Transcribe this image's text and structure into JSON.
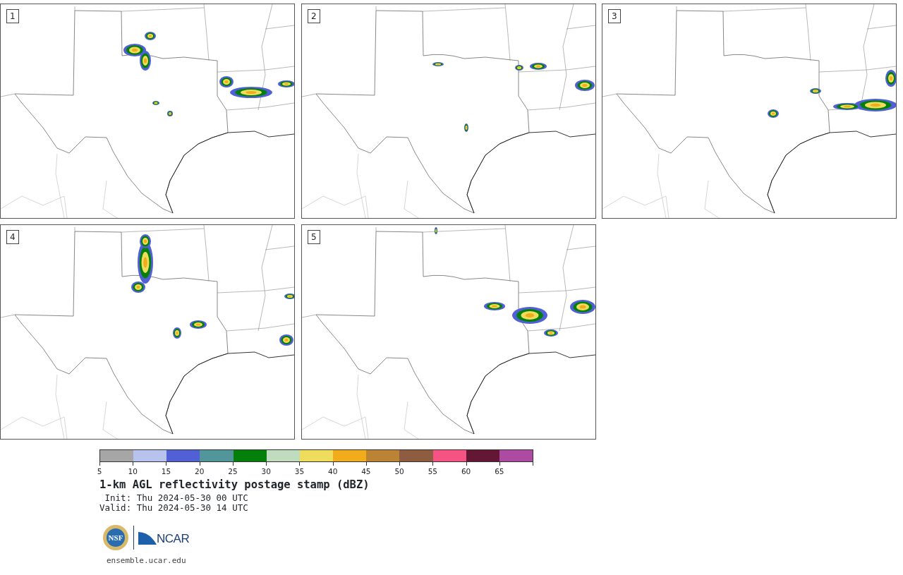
{
  "panels": [
    {
      "label": "1"
    },
    {
      "label": "2"
    },
    {
      "label": "3"
    },
    {
      "label": "4"
    },
    {
      "label": "5"
    }
  ],
  "colorbar": {
    "bins": [
      {
        "color": "#a6a6a6",
        "tick": "5"
      },
      {
        "color": "#b7c3ec",
        "tick": "10"
      },
      {
        "color": "#5260d6",
        "tick": "15"
      },
      {
        "color": "#52969b",
        "tick": "20"
      },
      {
        "color": "#04800a",
        "tick": "25"
      },
      {
        "color": "#bfddbe",
        "tick": "30"
      },
      {
        "color": "#efdb5c",
        "tick": "35"
      },
      {
        "color": "#f0ac1a",
        "tick": "40"
      },
      {
        "color": "#bb8334",
        "tick": "45"
      },
      {
        "color": "#8e5c40",
        "tick": "50"
      },
      {
        "color": "#f55383",
        "tick": "55"
      },
      {
        "color": "#631735",
        "tick": "60"
      },
      {
        "color": "#ad4ba3",
        "tick": "65"
      }
    ]
  },
  "title": "1-km AGL reflectivity postage stamp (dBZ)",
  "init": " Init: Thu 2024-05-30 00 UTC",
  "valid": "Valid: Thu 2024-05-30 14 UTC",
  "logo": {
    "nsf": "NSF",
    "ncar": "NCAR"
  },
  "url": "ensemble.ucar.edu"
}
